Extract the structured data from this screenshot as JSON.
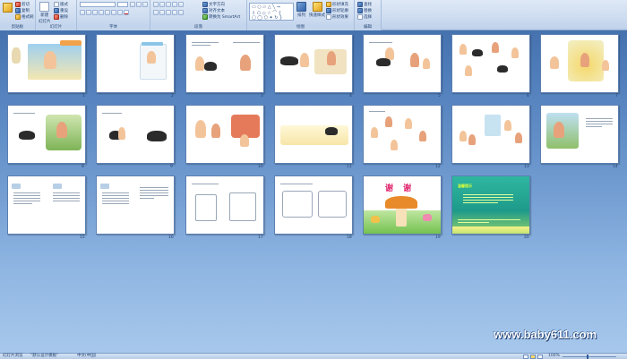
{
  "ribbon": {
    "groups": [
      {
        "label": "剪贴板"
      },
      {
        "label": "幻灯片"
      },
      {
        "label": "字体"
      },
      {
        "label": "段落"
      },
      {
        "label": "绘图"
      },
      {
        "label": "编辑"
      }
    ],
    "clipboard": {
      "cut": "剪切",
      "copy": "复制",
      "format_painter": "格式刷"
    },
    "slides": {
      "new_slide": "新建",
      "new_slide_sub": "幻灯片",
      "layout": "版式",
      "reset": "重设",
      "delete": "删除"
    },
    "font": {
      "font_name": "",
      "font_size": ""
    },
    "paragraph": {
      "text_direction": "文字方向",
      "align_text": "对齐文本",
      "smartart": "转换为 SmartArt"
    },
    "drawing": {
      "arrange": "排列",
      "quick_styles": "快速样式",
      "fill": "形状填充",
      "outline": "形状轮廓",
      "effects": "形状效果"
    },
    "editing": {
      "find": "查找",
      "replace": "替换",
      "select": "选择"
    }
  },
  "slides": [
    {
      "number": "1"
    },
    {
      "number": "2"
    },
    {
      "number": "3"
    },
    {
      "number": "4"
    },
    {
      "number": "5"
    },
    {
      "number": "6"
    },
    {
      "number": "7"
    },
    {
      "number": "8"
    },
    {
      "number": "9"
    },
    {
      "number": "10"
    },
    {
      "number": "11"
    },
    {
      "number": "12"
    },
    {
      "number": "13"
    },
    {
      "number": "14"
    },
    {
      "number": "15"
    },
    {
      "number": "16"
    },
    {
      "number": "17"
    },
    {
      "number": "18"
    },
    {
      "number": "19"
    },
    {
      "number": "20"
    }
  ],
  "slide19": {
    "title": "谢 谢"
  },
  "slide20": {
    "title": "温馨提示"
  },
  "status": {
    "view": "幻灯片浏览",
    "theme": "\"默认设计模板\"",
    "language": "中文(中国)",
    "zoom": "100%"
  },
  "watermark": "www.baby611.com",
  "colors": {
    "background_top": "#3f6aa6",
    "background_bottom": "#a9c9ec",
    "ribbon": "#cddcf0",
    "watermark": "#ffffff"
  }
}
